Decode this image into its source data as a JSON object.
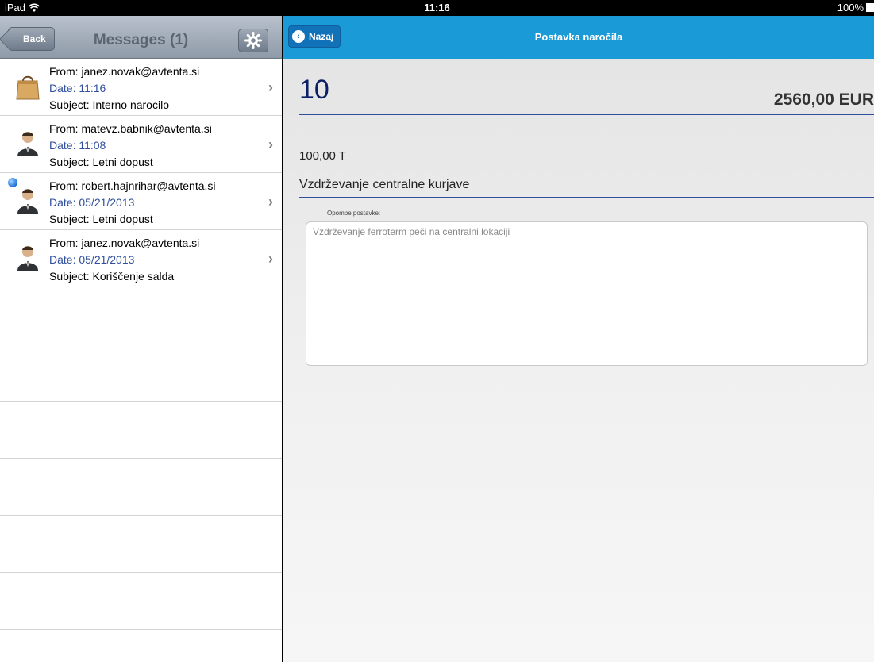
{
  "status_bar": {
    "carrier": "iPad",
    "time": "11:16",
    "battery": "100%"
  },
  "left_nav": {
    "back_label": "Back",
    "title": "Messages (1)",
    "settings_icon": "gear-icon"
  },
  "messages": [
    {
      "from": "From: janez.novak@avtenta.si",
      "date": "Date: 11:16",
      "subject": "Subject: Interno narocilo",
      "icon": "shopping-bag-icon",
      "unread": false
    },
    {
      "from": "From: matevz.babnik@avtenta.si",
      "date": "Date: 11:08",
      "subject": "Subject: Letni dopust",
      "icon": "user-icon",
      "unread": false
    },
    {
      "from": "From: robert.hajnrihar@avtenta.si",
      "date": "Date: 05/21/2013",
      "subject": "Subject: Letni dopust",
      "icon": "user-icon",
      "unread": true
    },
    {
      "from": "From: janez.novak@avtenta.si",
      "date": "Date: 05/21/2013",
      "subject": "Subject: Koriščenje salda",
      "icon": "user-icon",
      "unread": false
    }
  ],
  "right_nav": {
    "back_label": "Nazaj",
    "title": "Postavka naročila"
  },
  "detail": {
    "line_number": "10",
    "amount": "2560,00 EUR",
    "quantity": "100,00 T",
    "description": "Vzdrževanje centralne kurjave",
    "notes_label": "Opombe postavke:",
    "notes_text": "Vzdrževanje ferroterm peči na centralni lokaciji"
  },
  "colors": {
    "right_nav_bg": "#1a9bd8",
    "date_text": "#2f4f9c",
    "line_number": "#0b1f66"
  }
}
